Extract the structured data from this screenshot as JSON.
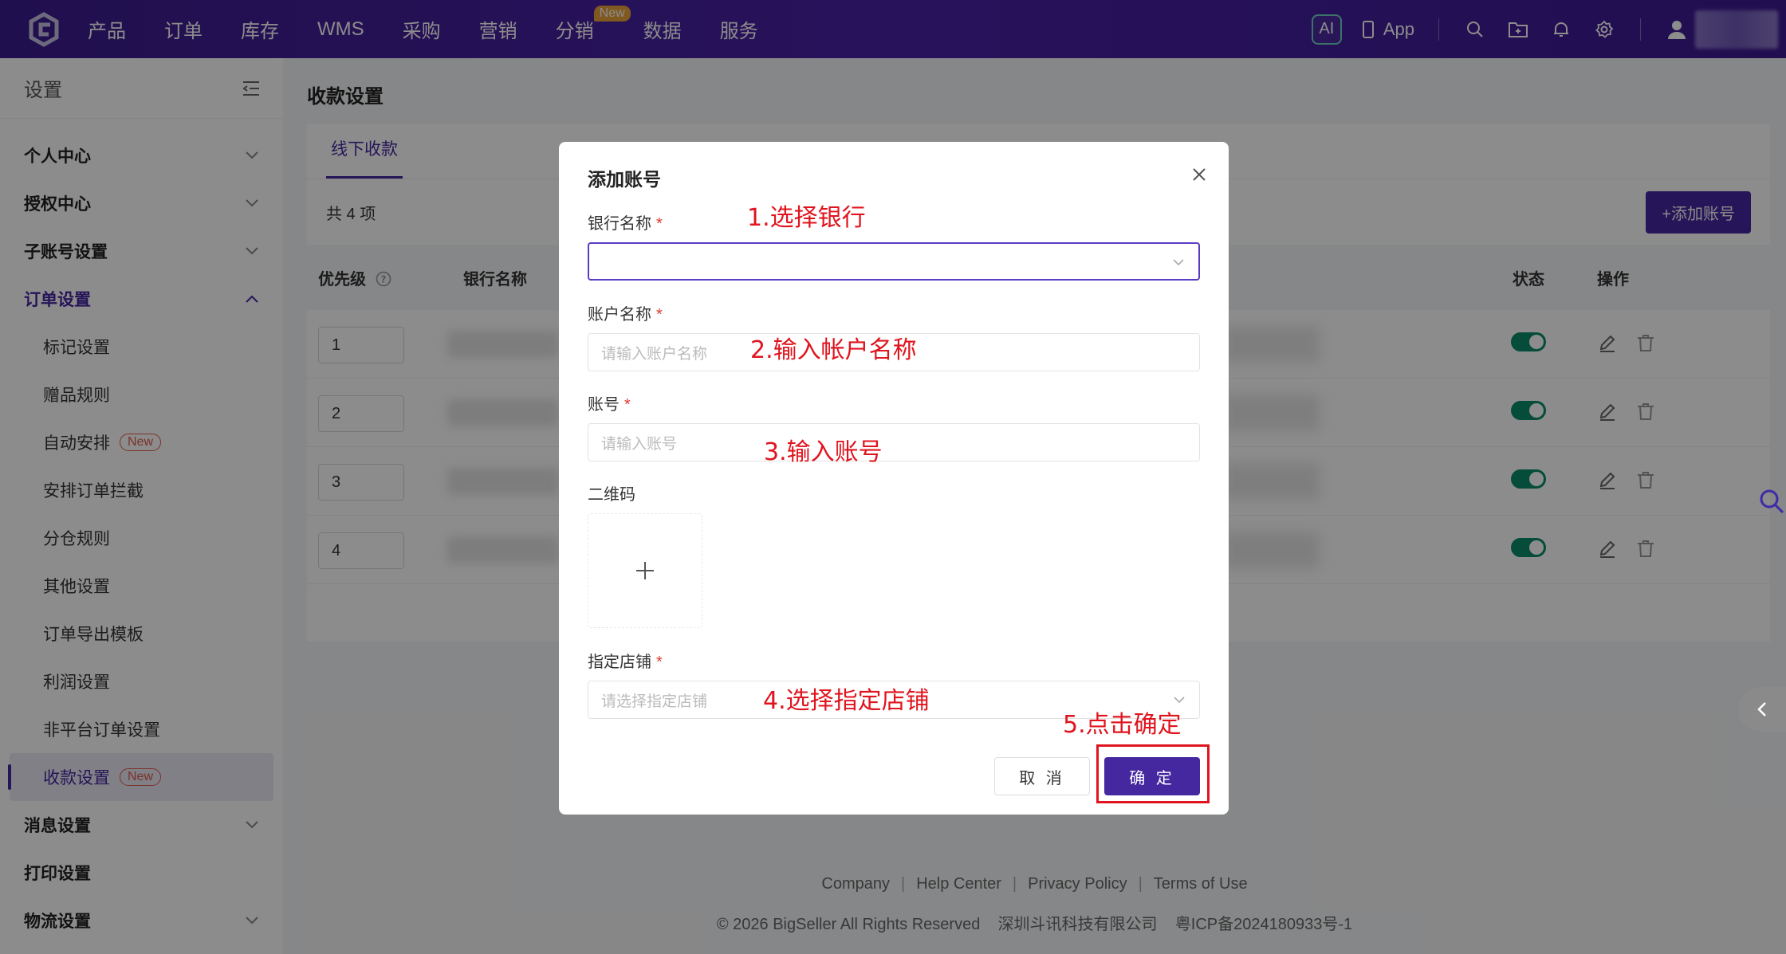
{
  "topnav": {
    "items": [
      {
        "label": "产品"
      },
      {
        "label": "订单"
      },
      {
        "label": "库存"
      },
      {
        "label": "WMS"
      },
      {
        "label": "采购"
      },
      {
        "label": "营销"
      },
      {
        "label": "分销",
        "badge": "New"
      },
      {
        "label": "数据"
      },
      {
        "label": "服务"
      }
    ],
    "ai_label": "AI",
    "app_label": "App",
    "icons": [
      "search-icon",
      "folder-icon",
      "bell-icon",
      "gear-icon",
      "user-icon"
    ]
  },
  "sidebar": {
    "title": "设置",
    "items": [
      {
        "label": "个人中心",
        "type": "group"
      },
      {
        "label": "授权中心",
        "type": "group"
      },
      {
        "label": "子账号设置",
        "type": "group"
      },
      {
        "label": "订单设置",
        "type": "group",
        "expanded": true
      },
      {
        "label": "标记设置",
        "type": "sub"
      },
      {
        "label": "赠品规则",
        "type": "sub"
      },
      {
        "label": "自动安排",
        "type": "sub",
        "tag": "New"
      },
      {
        "label": "安排订单拦截",
        "type": "sub"
      },
      {
        "label": "分仓规则",
        "type": "sub"
      },
      {
        "label": "其他设置",
        "type": "sub"
      },
      {
        "label": "订单导出模板",
        "type": "sub"
      },
      {
        "label": "利润设置",
        "type": "sub"
      },
      {
        "label": "非平台订单设置",
        "type": "sub"
      },
      {
        "label": "收款设置",
        "type": "sub",
        "tag": "New",
        "selected": true
      },
      {
        "label": "消息设置",
        "type": "group"
      },
      {
        "label": "打印设置",
        "type": "group"
      },
      {
        "label": "物流设置",
        "type": "group"
      }
    ]
  },
  "main": {
    "title": "收款设置",
    "tab": "线下收款",
    "count": "共 4 项",
    "add_button": "+添加账号",
    "columns": {
      "priority": "优先级",
      "bank": "银行名称",
      "status": "状态",
      "action": "操作"
    },
    "rows": [
      {
        "priority": "1",
        "enabled": true
      },
      {
        "priority": "2",
        "enabled": true
      },
      {
        "priority": "3",
        "enabled": true
      },
      {
        "priority": "4",
        "enabled": true
      }
    ]
  },
  "footer": {
    "links": [
      "Company",
      "Help Center",
      "Privacy Policy",
      "Terms of Use"
    ],
    "copyright": "© 2026 BigSeller All Rights Reserved    深圳斗讯科技有限公司    粤ICP备2024180933号-1"
  },
  "modal": {
    "title": "添加账号",
    "bank_label": "银行名称",
    "account_name_label": "账户名称",
    "account_name_placeholder": "请输入账户名称",
    "account_no_label": "账号",
    "account_no_placeholder": "请输入账号",
    "qr_label": "二维码",
    "store_label": "指定店铺",
    "store_placeholder": "请选择指定店铺",
    "required_mark": "*",
    "cancel": "取 消",
    "ok": "确 定"
  },
  "annotations": {
    "step1": "1.选择银行",
    "step2": "2.输入帐户名称",
    "step3": "3.输入账号",
    "step4": "4.选择指定店铺",
    "step5": "5.点击确定"
  },
  "colors": {
    "brand": "#4527a0",
    "toggle_on": "#0a8a6a",
    "annotation": "#e0141e",
    "badge": "#e9a23b"
  }
}
